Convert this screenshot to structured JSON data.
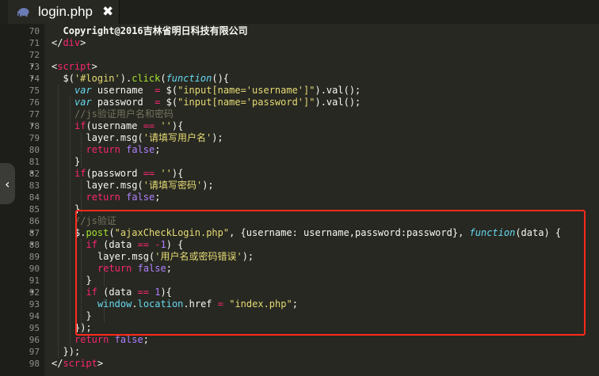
{
  "tab": {
    "title": "login.php",
    "close_glyph": "✖",
    "icon": "php-elephant-icon"
  },
  "gutter": {
    "line_numbers": [
      "70",
      "71",
      "72",
      "73",
      "74",
      "75",
      "76",
      "77",
      "78",
      "79",
      "80",
      "81",
      "82",
      "83",
      "84",
      "85",
      "86",
      "87",
      "88",
      "89",
      "90",
      "91",
      "92",
      "93",
      "94",
      "95",
      "96",
      "97",
      "98"
    ],
    "fold_arrows": {
      "73": "▾",
      "74": "▾",
      "78": "▾",
      "82": "▾",
      "87": "▾",
      "88": "▾",
      "92": "▾"
    }
  },
  "colors": {
    "background": "#272822",
    "keyword": "#f92672",
    "string": "#e6db74",
    "function": "#a6e22e",
    "storage": "#66d9ef",
    "comment": "#75715e",
    "number": "#ae81ff",
    "highlight_border": "#ff2a1a"
  },
  "code": [
    {
      "line": 70,
      "tokens": [
        [
          "w",
          "Copyright@2016吉林省明日科技有限公司"
        ]
      ]
    },
    {
      "line": 71,
      "tokens": [
        [
          "p",
          "</"
        ],
        [
          "k",
          "div"
        ],
        [
          "p",
          ">"
        ]
      ]
    },
    {
      "line": 72,
      "tokens": []
    },
    {
      "line": 73,
      "tokens": [
        [
          "p",
          "<"
        ],
        [
          "k",
          "script"
        ],
        [
          "p",
          ">"
        ]
      ]
    },
    {
      "line": 74,
      "tokens": [
        [
          "p",
          "$("
        ],
        [
          "s",
          "'#login'"
        ],
        [
          "p",
          ")."
        ],
        [
          "f",
          "click"
        ],
        [
          "p",
          "("
        ],
        [
          "i",
          "function"
        ],
        [
          "p",
          "(){"
        ]
      ]
    },
    {
      "line": 75,
      "tokens": [
        [
          "i",
          "var"
        ],
        [
          "p",
          " username  "
        ],
        [
          "k",
          "="
        ],
        [
          "p",
          " $("
        ],
        [
          "s",
          "\"input[name='username']\""
        ],
        [
          "p",
          ").val();"
        ]
      ]
    },
    {
      "line": 76,
      "tokens": [
        [
          "i",
          "var"
        ],
        [
          "p",
          " password  "
        ],
        [
          "k",
          "="
        ],
        [
          "p",
          " $("
        ],
        [
          "s",
          "\"input[name='password']\""
        ],
        [
          "p",
          ").val();"
        ]
      ]
    },
    {
      "line": 77,
      "tokens": [
        [
          "c",
          "//js验证用户名和密码"
        ]
      ]
    },
    {
      "line": 78,
      "tokens": [
        [
          "k",
          "if"
        ],
        [
          "p",
          "(username "
        ],
        [
          "k",
          "=="
        ],
        [
          "p",
          " "
        ],
        [
          "s",
          "''"
        ],
        [
          "p",
          "){"
        ]
      ]
    },
    {
      "line": 79,
      "tokens": [
        [
          "p",
          "layer.msg("
        ],
        [
          "s",
          "'请填写用户名'"
        ],
        [
          "p",
          ");"
        ]
      ]
    },
    {
      "line": 80,
      "tokens": [
        [
          "k",
          "return"
        ],
        [
          "p",
          " "
        ],
        [
          "n",
          "false"
        ],
        [
          "p",
          ";"
        ]
      ]
    },
    {
      "line": 81,
      "tokens": [
        [
          "p",
          "}"
        ]
      ]
    },
    {
      "line": 82,
      "tokens": [
        [
          "k",
          "if"
        ],
        [
          "p",
          "(password "
        ],
        [
          "k",
          "=="
        ],
        [
          "p",
          " "
        ],
        [
          "s",
          "''"
        ],
        [
          "p",
          "){"
        ]
      ]
    },
    {
      "line": 83,
      "tokens": [
        [
          "p",
          "layer.msg("
        ],
        [
          "s",
          "'请填写密码'"
        ],
        [
          "p",
          ");"
        ]
      ]
    },
    {
      "line": 84,
      "tokens": [
        [
          "k",
          "return"
        ],
        [
          "p",
          " "
        ],
        [
          "n",
          "false"
        ],
        [
          "p",
          ";"
        ]
      ]
    },
    {
      "line": 85,
      "tokens": [
        [
          "p",
          "}"
        ]
      ]
    },
    {
      "line": 86,
      "tokens": [
        [
          "c",
          "//js验证"
        ]
      ]
    },
    {
      "line": 87,
      "tokens": [
        [
          "p",
          "$."
        ],
        [
          "f",
          "post"
        ],
        [
          "p",
          "("
        ],
        [
          "s",
          "\"ajaxCheckLogin.php\""
        ],
        [
          "p",
          ", {username: username,password:password}, "
        ],
        [
          "i",
          "function"
        ],
        [
          "p",
          "(data) {"
        ]
      ]
    },
    {
      "line": 88,
      "tokens": [
        [
          "k",
          "if"
        ],
        [
          "p",
          " (data "
        ],
        [
          "k",
          "=="
        ],
        [
          "p",
          " "
        ],
        [
          "k",
          "-"
        ],
        [
          "n",
          "1"
        ],
        [
          "p",
          ") {"
        ]
      ]
    },
    {
      "line": 89,
      "tokens": [
        [
          "p",
          "layer.msg("
        ],
        [
          "s",
          "'用户名或密码错误'"
        ],
        [
          "p",
          ");"
        ]
      ]
    },
    {
      "line": 90,
      "tokens": [
        [
          "k",
          "return"
        ],
        [
          "p",
          " "
        ],
        [
          "n",
          "false"
        ],
        [
          "p",
          ";"
        ]
      ]
    },
    {
      "line": 91,
      "tokens": [
        [
          "p",
          "}"
        ]
      ]
    },
    {
      "line": 92,
      "tokens": [
        [
          "k",
          "if"
        ],
        [
          "p",
          " (data "
        ],
        [
          "k",
          "=="
        ],
        [
          "p",
          " "
        ],
        [
          "n",
          "1"
        ],
        [
          "p",
          "){"
        ]
      ]
    },
    {
      "line": 93,
      "tokens": [
        [
          "t",
          "window"
        ],
        [
          "p",
          "."
        ],
        [
          "t",
          "location"
        ],
        [
          "p",
          ".href "
        ],
        [
          "k",
          "="
        ],
        [
          "p",
          " "
        ],
        [
          "s",
          "\"index.php\""
        ],
        [
          "p",
          ";"
        ]
      ]
    },
    {
      "line": 94,
      "tokens": [
        [
          "p",
          "}"
        ]
      ]
    },
    {
      "line": 95,
      "tokens": [
        [
          "p",
          "});"
        ]
      ]
    },
    {
      "line": 96,
      "tokens": [
        [
          "k",
          "return"
        ],
        [
          "p",
          " "
        ],
        [
          "n",
          "false"
        ],
        [
          "p",
          ";"
        ]
      ]
    },
    {
      "line": 97,
      "tokens": [
        [
          "p",
          "});"
        ]
      ]
    },
    {
      "line": 98,
      "tokens": [
        [
          "p",
          "</"
        ],
        [
          "k",
          "script"
        ],
        [
          "p",
          ">"
        ]
      ]
    }
  ]
}
